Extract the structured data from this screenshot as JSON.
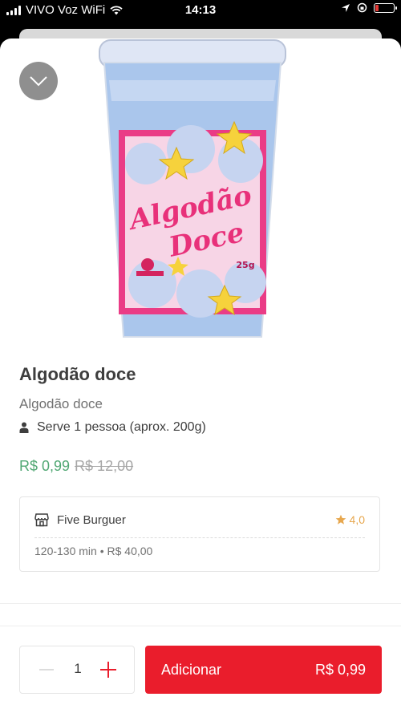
{
  "status_bar": {
    "carrier": "VIVO Voz WiFi",
    "time": "14:13"
  },
  "product": {
    "title": "Algodão doce",
    "description": "Algodão doce",
    "serves": "Serve 1 pessoa (aprox. 200g)",
    "price_new": "R$ 0,99",
    "price_old": "R$ 12,00",
    "image_text_1": "Algodão",
    "image_text_2": "Doce",
    "image_weight": "25g"
  },
  "store": {
    "name": "Five Burguer",
    "rating": "4,0",
    "meta": "120-130 min • R$ 40,00"
  },
  "cart": {
    "quantity": "1",
    "add_label": "Adicionar",
    "add_price": "R$ 0,99"
  },
  "colors": {
    "accent": "#ea1d2c",
    "price_green": "#50a773",
    "rating": "#e7a74e"
  }
}
